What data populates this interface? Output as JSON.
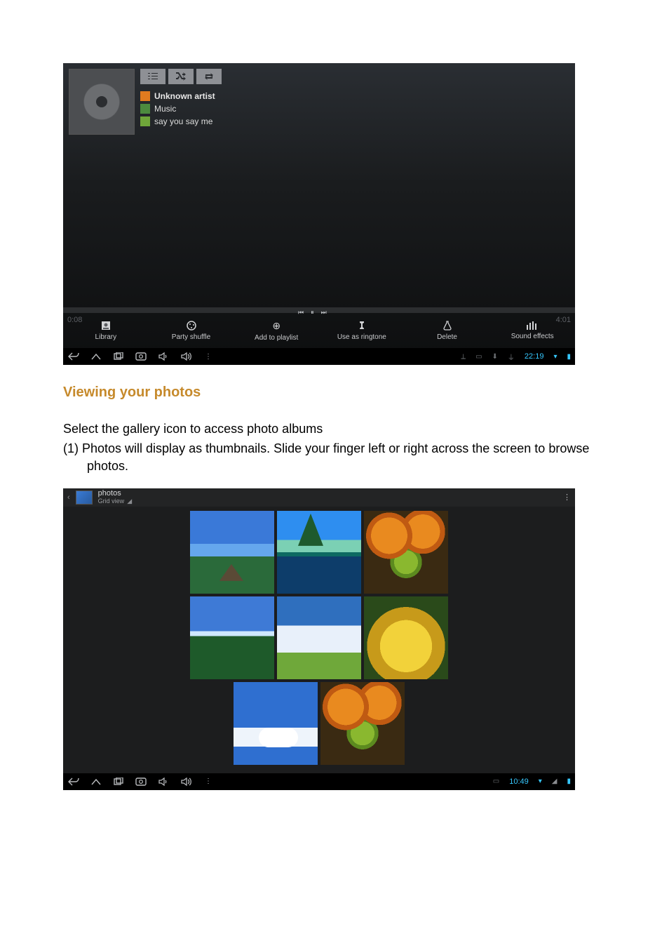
{
  "music": {
    "artist": "Unknown artist",
    "album": "Music",
    "track": "say you say me",
    "time_elapsed": "0:08",
    "time_total": "4:01",
    "actions": {
      "library": "Library",
      "party_shuffle": "Party shuffle",
      "add_playlist": "Add to playlist",
      "use_ringtone": "Use as ringtone",
      "delete": "Delete",
      "sound_effects": "Sound effects"
    },
    "status_time": "22:19"
  },
  "doc": {
    "heading": "Viewing your photos",
    "line1": "Select the gallery icon to access photo albums",
    "line2_prefix": "(1) ",
    "line2": "Photos will display as thumbnails. Slide your finger left or right across the screen to browse photos."
  },
  "gallery": {
    "title": "photos",
    "subtitle": "Grid view",
    "status_time": "10:49"
  }
}
